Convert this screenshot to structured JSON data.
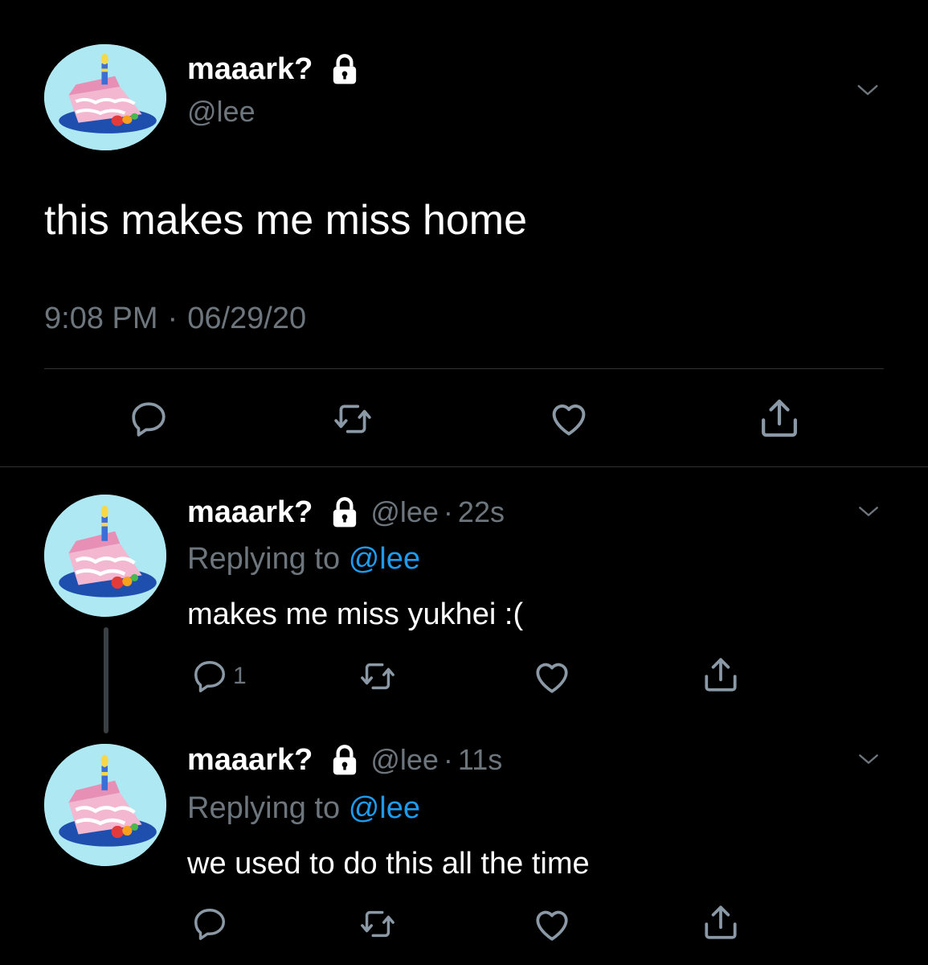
{
  "main_tweet": {
    "display_name": "maaark?",
    "handle": "@lee",
    "text": "this makes me miss home",
    "time": "9:08 PM",
    "separator": "·",
    "date": "06/29/20"
  },
  "replies": [
    {
      "display_name": "maaark?",
      "handle": "@lee",
      "dot": "·",
      "age": "22s",
      "replying_prefix": "Replying to",
      "replying_handle": "@lee",
      "text": "makes me miss yukhei :(",
      "reply_count": "1"
    },
    {
      "display_name": "maaark?",
      "handle": "@lee",
      "dot": "·",
      "age": "11s",
      "replying_prefix": "Replying to",
      "replying_handle": "@lee",
      "text": "we used to do this all the time",
      "reply_count": ""
    }
  ],
  "icons": {
    "lock": "lock-icon",
    "chevron": "chevron-down-icon",
    "reply": "reply-icon",
    "retweet": "retweet-icon",
    "like": "heart-icon",
    "share": "share-icon"
  },
  "colors": {
    "background": "#000000",
    "text": "#ffffff",
    "muted": "#6e767d",
    "link": "#1d9bf0",
    "divider": "#2f3336",
    "avatar_bg": "#aee8f3"
  }
}
